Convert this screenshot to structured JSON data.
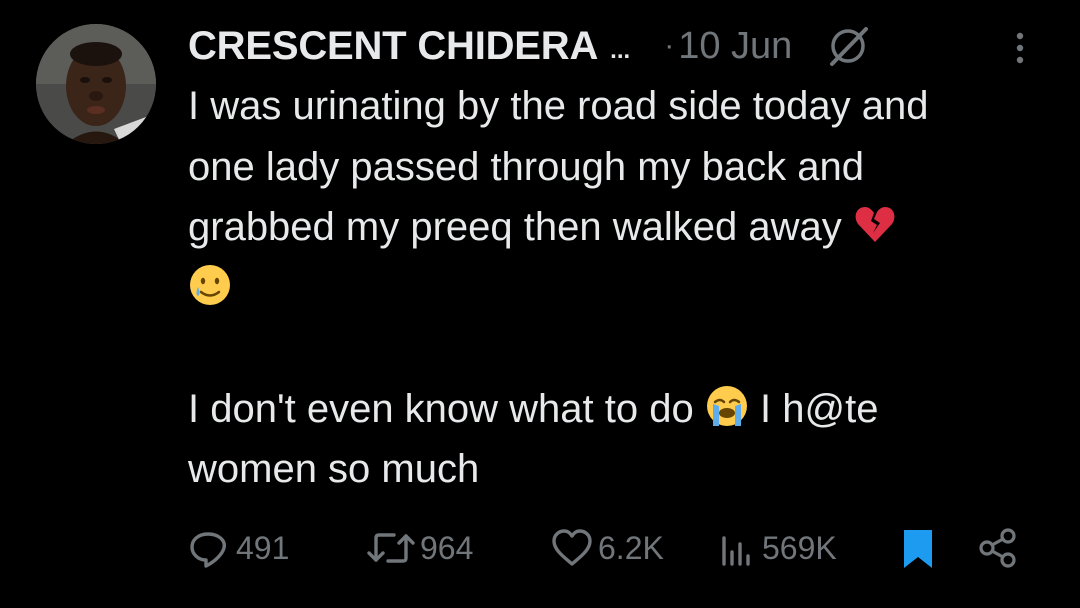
{
  "tweet": {
    "author": {
      "display_name": "CRESCENT CHIDERA",
      "truncation": "...",
      "avatar_icon": "avatar-photo"
    },
    "separator": "·",
    "date": "10 Jun",
    "body_lines": [
      "I was urinating by the road side today and",
      "one lady passed through my back and",
      "grabbed my preeq then walked away",
      "",
      "",
      "I don't even know what to do",
      "I h@te",
      "women so much"
    ],
    "emojis": {
      "broken_heart": "💔",
      "smile_tear": "🥲",
      "crying": "😭"
    },
    "metrics": {
      "replies": "491",
      "reposts": "964",
      "likes": "6.2K",
      "views": "569K"
    },
    "colors": {
      "background": "#000000",
      "text": "#e7e9ea",
      "muted": "#71767b",
      "bookmark_active": "#1d9bf0"
    },
    "icons": {
      "header": [
        "grok-icon",
        "more-options-icon"
      ],
      "actions": [
        "reply-icon",
        "repost-icon",
        "like-icon",
        "views-icon",
        "bookmark-icon",
        "share-icon"
      ]
    }
  }
}
